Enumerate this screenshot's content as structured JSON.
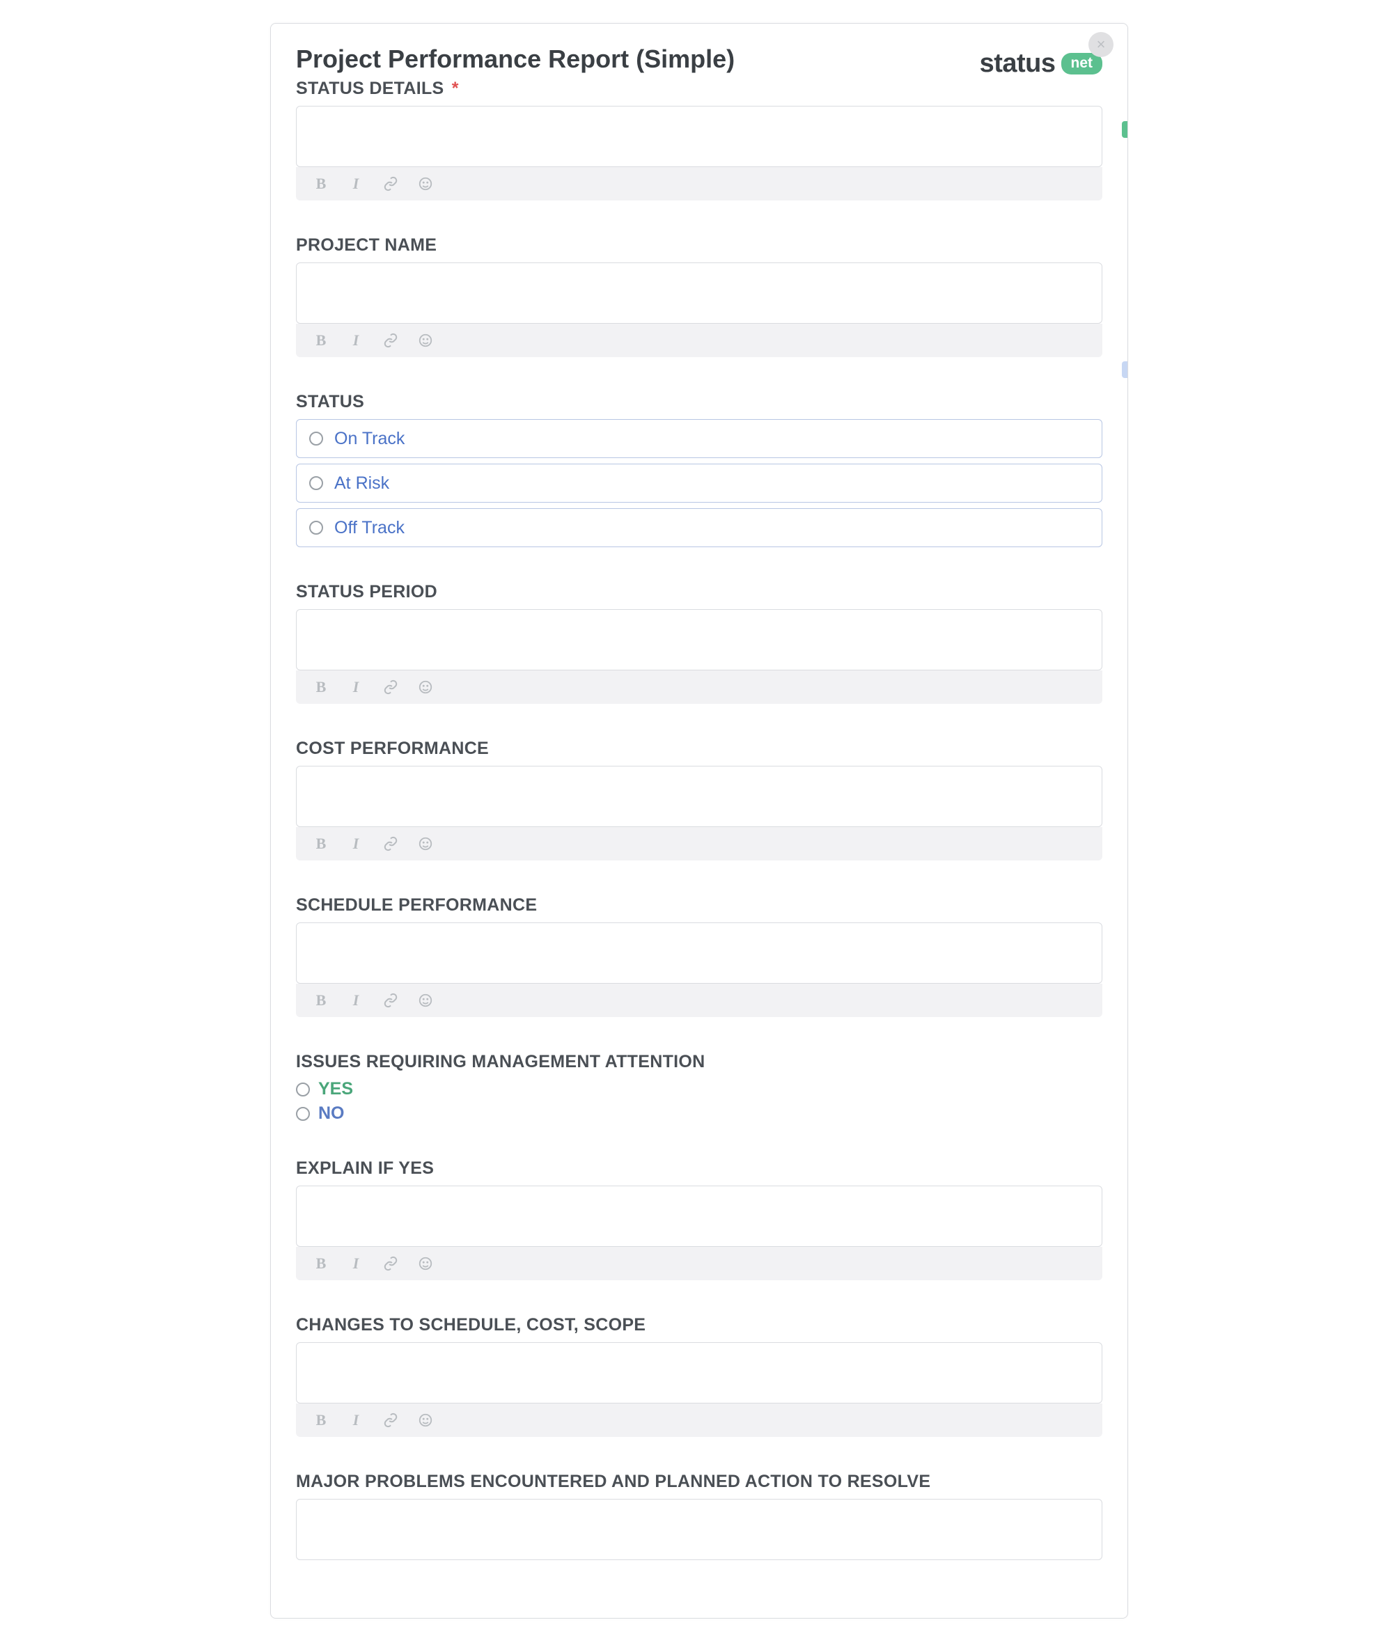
{
  "logo": {
    "brand": "status",
    "badge": "net"
  },
  "form": {
    "title": "Project Performance Report (Simple)",
    "fields": {
      "status_details": {
        "label": "STATUS DETAILS",
        "required": true
      },
      "project_name": {
        "label": "PROJECT NAME"
      },
      "status": {
        "label": "STATUS",
        "options": [
          "On Track",
          "At Risk",
          "Off Track"
        ]
      },
      "status_period": {
        "label": "STATUS PERIOD"
      },
      "cost_perf": {
        "label": "COST PERFORMANCE"
      },
      "schedule_perf": {
        "label": "SCHEDULE PERFORMANCE"
      },
      "issues": {
        "label": "ISSUES REQUIRING MANAGEMENT ATTENTION",
        "options": [
          "YES",
          "NO"
        ]
      },
      "explain": {
        "label": "EXPLAIN IF YES"
      },
      "changes": {
        "label": "CHANGES TO SCHEDULE, COST, SCOPE"
      },
      "major_problems": {
        "label": "MAJOR PROBLEMS ENCOUNTERED AND PLANNED ACTION TO RESOLVE"
      }
    }
  },
  "required_mark": "*",
  "close_glyph": "×"
}
